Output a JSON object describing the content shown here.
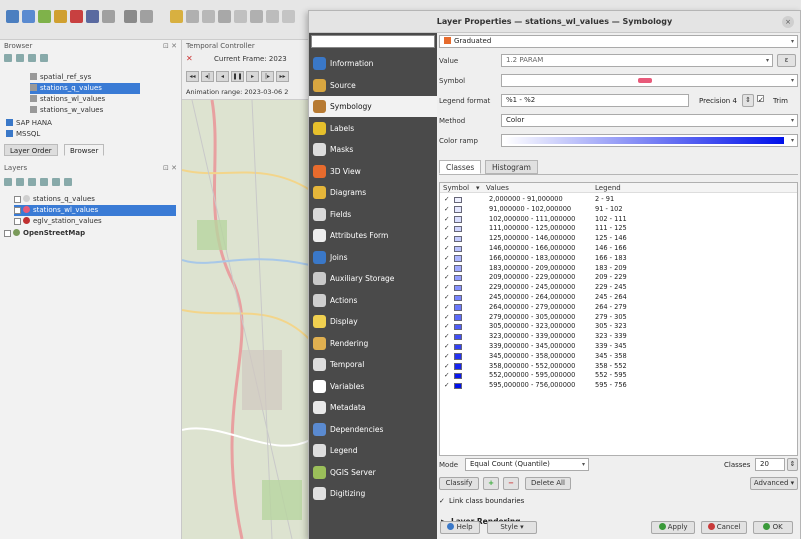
{
  "app": {
    "browser_title": "Browser",
    "browser_items": [
      {
        "label": "spatial_ref_sys",
        "selected": false
      },
      {
        "label": "stations_q_values",
        "selected": true
      },
      {
        "label": "stations_wl_values",
        "selected": false
      },
      {
        "label": "stations_w_values",
        "selected": false
      },
      {
        "label": "SAP HANA",
        "selected": false
      },
      {
        "label": "MSSQL",
        "selected": false
      }
    ],
    "dock_tabs": [
      "Layer Order",
      "Browser"
    ],
    "layers_title": "Layers",
    "layer_items": [
      {
        "label": "stations_q_values",
        "selected": false,
        "bold": false
      },
      {
        "label": "stations_wl_values",
        "selected": true,
        "bold": false
      },
      {
        "label": "eglv_station_values",
        "selected": false,
        "bold": false
      },
      {
        "label": "OpenStreetMap",
        "selected": false,
        "bold": true
      }
    ],
    "temporal_title": "Temporal Controller",
    "current_frame": "Current Frame: 2023",
    "animation_range": "Animation range: 2023-03-06 2"
  },
  "dialog": {
    "title": "Layer Properties — stations_wl_values — Symbology",
    "close_glyph": "×",
    "search_placeholder": "",
    "nav_items": [
      {
        "label": "Information",
        "icon": "information-icon",
        "color": "#3a78c8"
      },
      {
        "label": "Source",
        "icon": "source-icon",
        "color": "#d8a640"
      },
      {
        "label": "Symbology",
        "icon": "symbology-icon",
        "color": "#b77a32"
      },
      {
        "label": "Labels",
        "icon": "labels-icon",
        "color": "#e6c02c"
      },
      {
        "label": "Masks",
        "icon": "masks-icon",
        "color": "#dcdcdc"
      },
      {
        "label": "3D View",
        "icon": "3d-view-icon",
        "color": "#e86b2d"
      },
      {
        "label": "Diagrams",
        "icon": "diagrams-icon",
        "color": "#e5b63a"
      },
      {
        "label": "Fields",
        "icon": "fields-icon",
        "color": "#d9d9d9"
      },
      {
        "label": "Attributes Form",
        "icon": "attributes-form-icon",
        "color": "#eeeeee"
      },
      {
        "label": "Joins",
        "icon": "joins-icon",
        "color": "#3a78c8"
      },
      {
        "label": "Auxiliary Storage",
        "icon": "auxiliary-storage-icon",
        "color": "#c9c9c9"
      },
      {
        "label": "Actions",
        "icon": "actions-icon",
        "color": "#cfcfcf"
      },
      {
        "label": "Display",
        "icon": "display-icon",
        "color": "#f0d050"
      },
      {
        "label": "Rendering",
        "icon": "rendering-icon",
        "color": "#e0b050"
      },
      {
        "label": "Temporal",
        "icon": "temporal-icon",
        "color": "#dddddd"
      },
      {
        "label": "Variables",
        "icon": "variables-icon",
        "color": "#ffffff"
      },
      {
        "label": "Metadata",
        "icon": "metadata-icon",
        "color": "#e8e8e8"
      },
      {
        "label": "Dependencies",
        "icon": "dependencies-icon",
        "color": "#5a8ad0"
      },
      {
        "label": "Legend",
        "icon": "legend-icon",
        "color": "#dddddd"
      },
      {
        "label": "QGIS Server",
        "icon": "qgis-server-icon",
        "color": "#9bbf5a"
      },
      {
        "label": "Digitizing",
        "icon": "digitizing-icon",
        "color": "#e0e0e0"
      }
    ],
    "active_nav": 2,
    "renderer": "Graduated",
    "labels": {
      "value": "Value",
      "symbol": "Symbol",
      "legend_format": "Legend format",
      "method": "Method",
      "color_ramp": "Color ramp",
      "precision": "Precision 4",
      "trim": "Trim"
    },
    "value_field": "1.2 PARAM",
    "legend_format_value": "%1 - %2",
    "method_value": "Color",
    "tabs": [
      "Classes",
      "Histogram"
    ],
    "table_headers": {
      "symbol": "Symbol",
      "values": "Values",
      "legend": "Legend"
    },
    "classes": [
      {
        "values": "2,000000 - 91,000000",
        "legend": "2 - 91",
        "color": "#eef0ff"
      },
      {
        "values": "91,000000 - 102,000000",
        "legend": "91 - 102",
        "color": "#e4e7ff"
      },
      {
        "values": "102,000000 - 111,000000",
        "legend": "102 - 111",
        "color": "#d9deff"
      },
      {
        "values": "111,000000 - 125,000000",
        "legend": "111 - 125",
        "color": "#ced4ff"
      },
      {
        "values": "125,000000 - 146,000000",
        "legend": "125 - 146",
        "color": "#c3cbff"
      },
      {
        "values": "146,000000 - 166,000000",
        "legend": "146 - 166",
        "color": "#b8c1ff"
      },
      {
        "values": "166,000000 - 183,000000",
        "legend": "166 - 183",
        "color": "#acb6ff"
      },
      {
        "values": "183,000000 - 209,000000",
        "legend": "183 - 209",
        "color": "#a0aaff"
      },
      {
        "values": "209,000000 - 229,000000",
        "legend": "209 - 229",
        "color": "#939eff"
      },
      {
        "values": "229,000000 - 245,000000",
        "legend": "229 - 245",
        "color": "#8692ff"
      },
      {
        "values": "245,000000 - 264,000000",
        "legend": "245 - 264",
        "color": "#7885ff"
      },
      {
        "values": "264,000000 - 279,000000",
        "legend": "264 - 279",
        "color": "#6a78fc"
      },
      {
        "values": "279,000000 - 305,000000",
        "legend": "279 - 305",
        "color": "#5c6afa"
      },
      {
        "values": "305,000000 - 323,000000",
        "legend": "305 - 323",
        "color": "#4e5cf8"
      },
      {
        "values": "323,000000 - 339,000000",
        "legend": "323 - 339",
        "color": "#404ef6"
      },
      {
        "values": "339,000000 - 345,000000",
        "legend": "339 - 345",
        "color": "#3240f4"
      },
      {
        "values": "345,000000 - 358,000000",
        "legend": "345 - 358",
        "color": "#2432f2"
      },
      {
        "values": "358,000000 - 552,000000",
        "legend": "358 - 552",
        "color": "#1624f0"
      },
      {
        "values": "552,000000 - 595,000000",
        "legend": "552 - 595",
        "color": "#0a18ee"
      },
      {
        "values": "595,000000 - 756,000000",
        "legend": "595 - 756",
        "color": "#0010ea"
      }
    ],
    "mode_label": "Mode",
    "mode_value": "Equal Count (Quantile)",
    "classes_label": "Classes",
    "classes_count": "20",
    "classify_label": "Classify",
    "add_glyph": "+",
    "remove_glyph": "−",
    "delete_all_label": "Delete All",
    "advanced_label": "Advanced",
    "link_boundaries_label": "Link class boundaries",
    "layer_rendering_label": "Layer Rendering",
    "help_label": "Help",
    "style_label": "Style",
    "apply_label": "Apply",
    "cancel_label": "Cancel",
    "ok_label": "OK",
    "ramp_start": "#ffffff",
    "ramp_end": "#0010ea",
    "symbol_color": "#e85a7a"
  }
}
